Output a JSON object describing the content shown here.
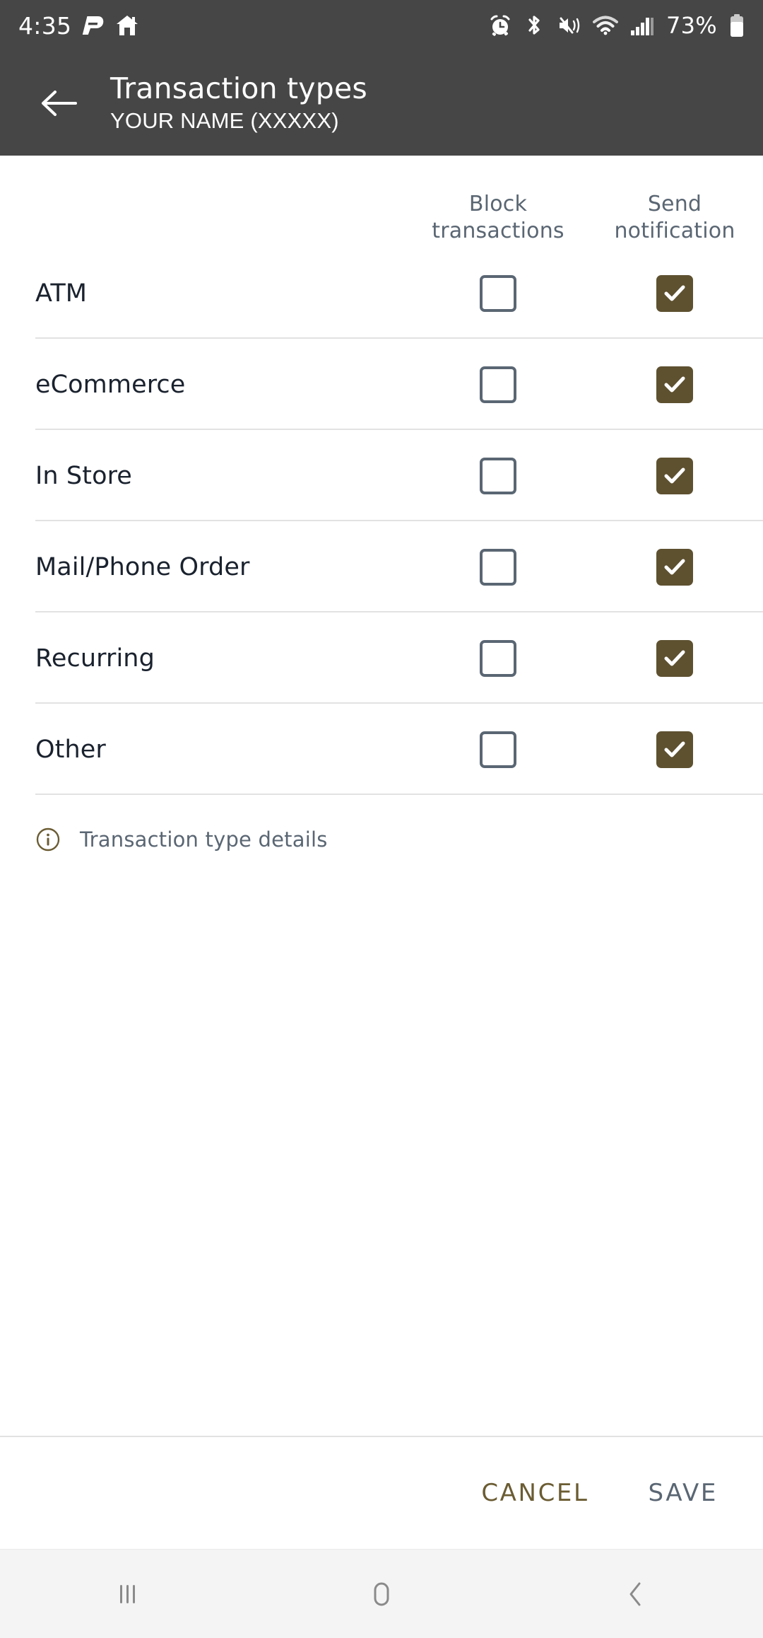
{
  "status_bar": {
    "time": "4:35",
    "left_icons": [
      "app-p-icon",
      "home-icon"
    ],
    "right_icons": [
      "alarm-icon",
      "bluetooth-icon",
      "mute-vibrate-icon",
      "wifi-icon",
      "cellular-signal-icon"
    ],
    "battery_percent": "73%",
    "background_color": "#464646"
  },
  "app_bar": {
    "back_icon": "back-arrow-icon",
    "title": "Transaction types",
    "subtitle": "YOUR NAME (XXXXX)",
    "background_color": "#464646",
    "text_color": "#ffffff"
  },
  "table": {
    "columns": [
      {
        "id": "block",
        "line1": "Block",
        "line2": "transactions"
      },
      {
        "id": "notify",
        "line1": "Send",
        "line2": "notification"
      }
    ],
    "rows": [
      {
        "label": "ATM",
        "block_transactions": false,
        "send_notification": true
      },
      {
        "label": "eCommerce",
        "block_transactions": false,
        "send_notification": true
      },
      {
        "label": "In Store",
        "block_transactions": false,
        "send_notification": true
      },
      {
        "label": "Mail/Phone Order",
        "block_transactions": false,
        "send_notification": true
      },
      {
        "label": "Recurring",
        "block_transactions": false,
        "send_notification": true
      },
      {
        "label": "Other",
        "block_transactions": false,
        "send_notification": true
      }
    ]
  },
  "info": {
    "icon": "info-circle-icon",
    "text": "Transaction type details",
    "icon_color": "#6b5c33",
    "text_color": "#5a6673"
  },
  "actions": {
    "cancel_label": "CANCEL",
    "save_label": "SAVE",
    "cancel_color": "#6b5c33",
    "save_color": "#5a6673"
  },
  "nav_bar": {
    "recents_icon": "recents-icon",
    "home_icon": "home-square-icon",
    "back_icon": "back-chevron-icon",
    "background_color": "#f4f4f4"
  },
  "theme": {
    "checked_fill": "#5e5130",
    "unchecked_border": "#5a6673",
    "divider": "#e2e2e2",
    "row_label": "#1a222e"
  }
}
